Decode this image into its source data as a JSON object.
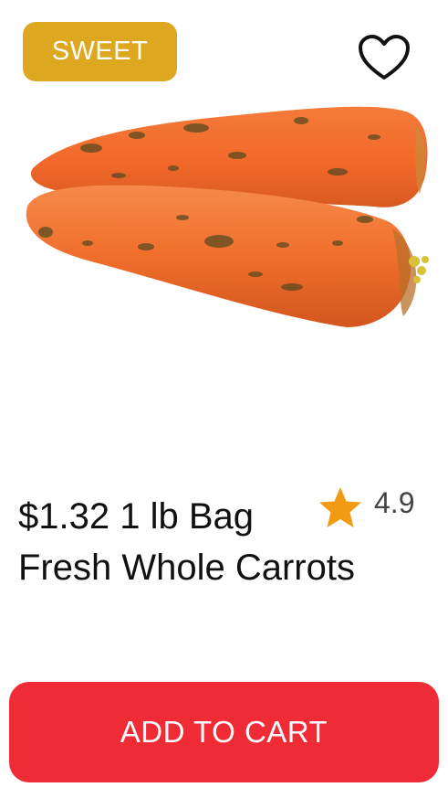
{
  "badge": {
    "label": "SWEET",
    "color": "#DDA81F"
  },
  "favorite": {
    "icon": "heart-outline-icon"
  },
  "product": {
    "image": "carrots-image",
    "title_line1": "$1.32 1 lb Bag",
    "title_line2": "Fresh Whole Carrots",
    "rating": "4.9",
    "rating_icon": "star-icon",
    "star_color": "#F29A11"
  },
  "cta": {
    "label": "ADD TO CART",
    "color": "#EF2C36"
  }
}
